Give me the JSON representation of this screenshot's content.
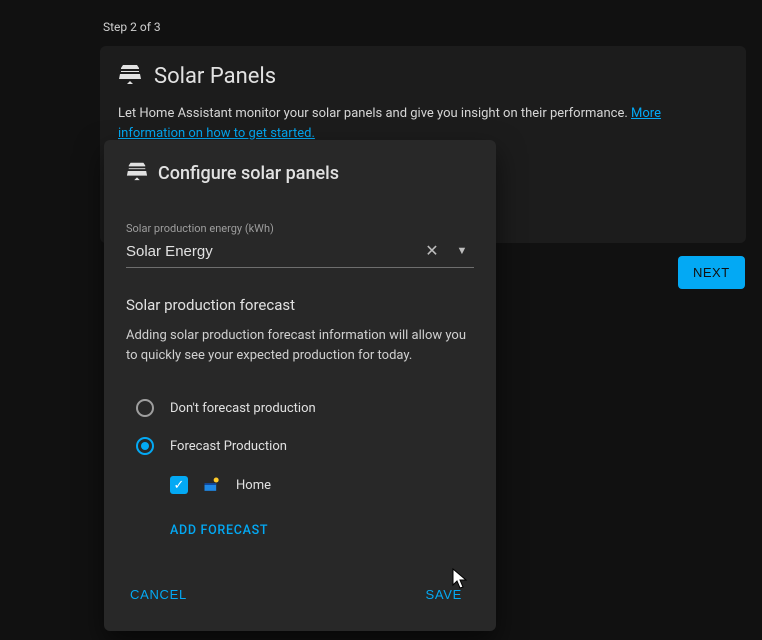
{
  "step_label": "Step 2 of 3",
  "page": {
    "title": "Solar Panels",
    "description_pre": "Let Home Assistant monitor your solar panels and give you insight on their performance. ",
    "description_link": "More information on how to get started.",
    "next_button": "NEXT"
  },
  "dialog": {
    "title": "Configure solar panels",
    "field_label": "Solar production energy (kWh)",
    "field_value": "Solar Energy",
    "forecast_section_title": "Solar production forecast",
    "forecast_section_desc": "Adding solar production forecast information will allow you to quickly see your expected production for today.",
    "radios": {
      "no_forecast": "Don't forecast production",
      "forecast": "Forecast Production",
      "selected": "forecast"
    },
    "forecast_child": {
      "checked": true,
      "label": "Home"
    },
    "add_forecast": "ADD FORECAST",
    "cancel": "CANCEL",
    "save": "SAVE"
  }
}
